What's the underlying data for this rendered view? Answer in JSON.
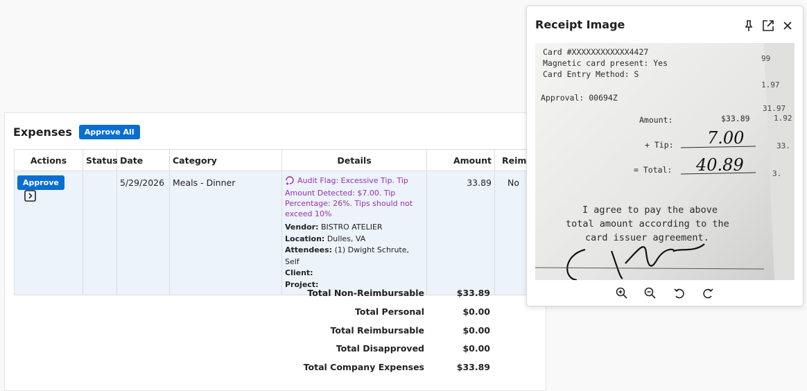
{
  "expenses": {
    "title": "Expenses",
    "approve_all_label": "Approve All",
    "columns": [
      "Actions",
      "Status",
      "Date",
      "Category",
      "Details",
      "Amount",
      "Reim."
    ],
    "row": {
      "approve_label": "Approve",
      "status": "",
      "date": "5/29/2026",
      "category": "Meals - Dinner",
      "audit_flag": "Audit Flag: Excessive Tip. Tip Amount Detected: $7.00. Tip Percentage: 26%. Tips should not exceed 10%",
      "vendor_label": "Vendor:",
      "vendor": "BISTRO ATELIER",
      "location_label": "Location:",
      "location": "Dulles, VA",
      "attendees_label": "Attendees:",
      "attendees": "(1) Dwight Schrute, Self",
      "client_label": "Client:",
      "client": "",
      "project_label": "Project:",
      "project": "",
      "amount": "33.89",
      "reimbursable": "No"
    },
    "totals": [
      {
        "label": "Total Non-Reimbursable",
        "value": "$33.89"
      },
      {
        "label": "Total Personal",
        "value": "$0.00"
      },
      {
        "label": "Total Reimbursable",
        "value": "$0.00"
      },
      {
        "label": "Total Disapproved",
        "value": "$0.00"
      },
      {
        "label": "Total Company Expenses",
        "value": "$33.89"
      }
    ]
  },
  "receipt_panel": {
    "title": "Receipt Image",
    "tools": [
      "pin-icon",
      "open-new-window-icon",
      "close-icon"
    ],
    "zoom_tools": [
      "zoom-in-icon",
      "zoom-out-icon",
      "rotate-left-icon",
      "rotate-right-icon"
    ],
    "receipt": {
      "card_line": "Card #XXXXXXXXXXXX4427",
      "magnetic_line": "Magnetic card present: Yes",
      "entry_line": "Card Entry Method:  S",
      "approval_line": "Approval: 00694Z",
      "amount_label": "Amount:",
      "amount_value": "$33.89",
      "tip_label": "+ Tip:",
      "tip_value": "7.00",
      "total_label": "= Total:",
      "total_value": "40.89",
      "agree_line1": "I agree to pay the above",
      "agree_line2": "total amount according to the",
      "agree_line3": "card issuer agreement.",
      "back_numbers": [
        "99",
        "1.97",
        "31.97",
        "1.92",
        "33.",
        "3."
      ]
    }
  },
  "colors": {
    "accent": "#0a6ed1",
    "flag": "#9b2fae",
    "row_bg": "#ecf3fb"
  }
}
